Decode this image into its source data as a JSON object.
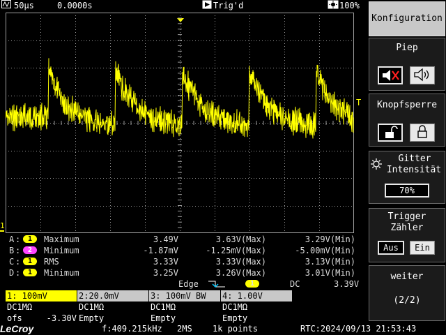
{
  "topbar": {
    "timebase": "50µs",
    "delay": "0.0000s",
    "trigger_state": "Trig'd",
    "battery": "100%"
  },
  "channel_marker": "1",
  "trigger_level_marker": "T",
  "measurements": [
    {
      "ch": "A",
      "src": "1",
      "param": "Maximum",
      "value": "3.49V",
      "max": "3.63V(Max)",
      "min": "3.29V(Min)",
      "color": "#ffff00"
    },
    {
      "ch": "B",
      "src": "2",
      "param": "Minimum",
      "value": "-1.87mV",
      "max": "-1.25mV(Max)",
      "min": "-5.00mV(Min)",
      "color": "#ff44ff"
    },
    {
      "ch": "C",
      "src": "1",
      "param": "RMS",
      "value": "3.33V",
      "max": "3.33V(Max)",
      "min": "3.13V(Min)",
      "color": "#ffff00"
    },
    {
      "ch": "D",
      "src": "1",
      "param": "Minimum",
      "value": "3.25V",
      "max": "3.26V(Max)",
      "min": "3.01V(Min)",
      "color": "#ffff00"
    }
  ],
  "trigger": {
    "type": "Edge",
    "source": "1",
    "coupling": "DC",
    "level": "3.39V"
  },
  "channels": [
    {
      "head": "1: 100mV",
      "coupling": "DC1MΩ",
      "extra_label": "ofs",
      "extra_value": "-3.30V",
      "active": true
    },
    {
      "head": "2:20.0mV",
      "coupling": "DC1MΩ",
      "extra_label": "Empty",
      "extra_value": "",
      "active": false
    },
    {
      "head": "3: 100mV  BW",
      "coupling": "DC1MΩ",
      "extra_label": "Empty",
      "extra_value": "",
      "active": false
    },
    {
      "head": "4: 1.00V",
      "coupling": "DC1MΩ",
      "extra_label": "Empty",
      "extra_value": "",
      "active": false
    }
  ],
  "bottombar": {
    "logo": "LeCroy",
    "frequency": "f:409.215kHz",
    "sample_rate": "2MS",
    "points": "1k points",
    "rtc": "RTC:2024/09/13 21:53:43"
  },
  "menu": {
    "config": "Konfiguration",
    "beep": "Piep",
    "keylock": "Knopfsperre",
    "grid_title_1": "Gitter",
    "grid_title_2": "Intensität",
    "grid_value": "70%",
    "trigger_title_1": "Trigger",
    "trigger_title_2": "Zähler",
    "trigger_off": "Aus",
    "trigger_on": "Ein",
    "next": "weiter",
    "page": "(2/2)"
  }
}
